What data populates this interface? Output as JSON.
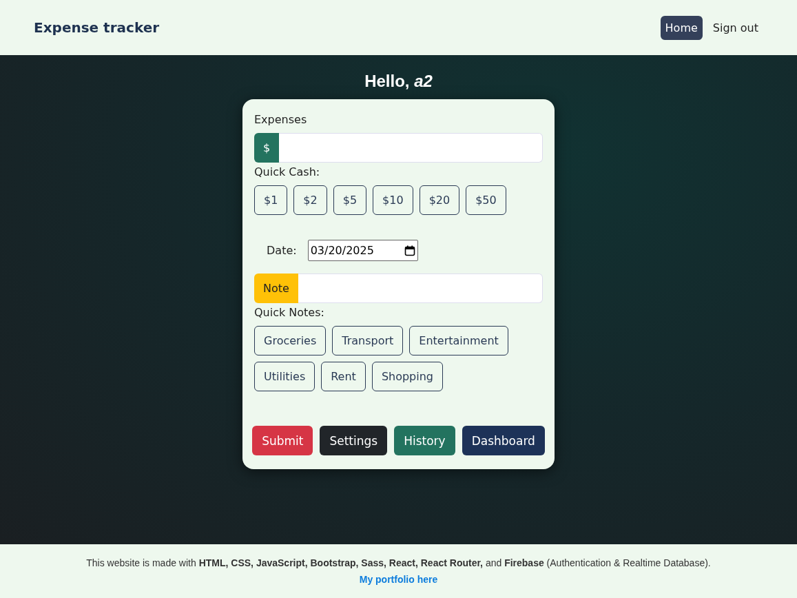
{
  "header": {
    "title": "Expense tracker",
    "nav": [
      {
        "label": "Home",
        "selected": true
      },
      {
        "label": "Sign out",
        "selected": false
      }
    ]
  },
  "greeting": "Hello, *a2*",
  "form": {
    "expense_label": "Expenses",
    "currency_prefix": "$",
    "quick_cash_label": "Quick Cash:",
    "quick_cash": [
      "$1",
      "$2",
      "$5",
      "$10",
      "$20",
      "$50"
    ],
    "date_label": "Date:",
    "date_value": "03/20/2025",
    "note_prefix": "Note",
    "quick_notes_label": "Quick Notes:",
    "quick_notes": [
      "Groceries",
      "Transport",
      "Entertainment",
      "Utilities",
      "Rent",
      "Shopping"
    ],
    "actions": [
      {
        "label": "Submit",
        "kind": "danger"
      },
      {
        "label": "Settings",
        "kind": "dark"
      },
      {
        "label": "History",
        "kind": "teal"
      },
      {
        "label": "Dashboard",
        "kind": "navy"
      }
    ]
  },
  "footer": {
    "text": "This website is made with **HTML, CSS, JavaScript, Bootstrap, Sass, React, React Router,** and **Firebase** (Authentication & Realtime Database).",
    "link": "My portfolio here"
  }
}
